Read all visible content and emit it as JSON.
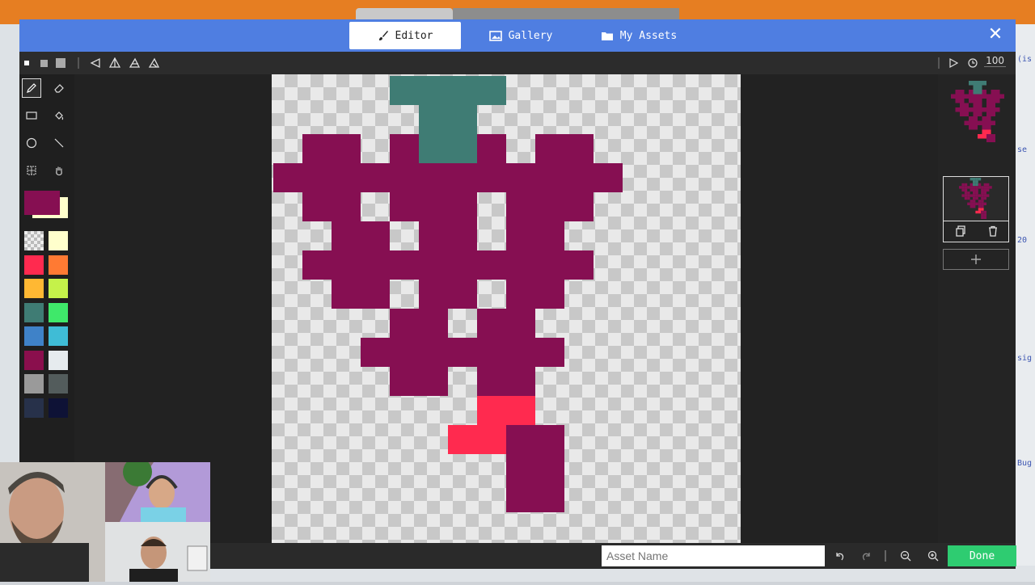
{
  "tabs": [
    {
      "label": "Editor",
      "icon": "brush-icon"
    },
    {
      "label": "Gallery",
      "icon": "image-icon"
    },
    {
      "label": "My Assets",
      "icon": "folder-icon"
    }
  ],
  "toolbar": {
    "timer": "100"
  },
  "asset_name": {
    "placeholder": "Asset Name",
    "value": ""
  },
  "done_label": "Done",
  "palette": [
    "#ffffcc",
    "#ff2a4f",
    "#ff7a33",
    "#ffb833",
    "#c5f24a",
    "#3f7c74",
    "#3fe86a",
    "#3f82c8",
    "#3fbcd6",
    "#8a0f4d",
    "#e6ebee",
    "#9a9a9a",
    "#535c5c",
    "#27314a",
    "#0e1236"
  ],
  "colors": {
    "primary": "#860f52",
    "secondary": "#ffffcc",
    "stem": "#3f7c74",
    "accent": "#ff2a4f",
    "header": "#4f7ee1",
    "done": "#2ecc71"
  },
  "pixels": [
    "....0000....",
    ".....00.....",
    ".11.1001.11.",
    "111111111111",
    ".11.111.111.",
    "..11.11.11..",
    ".1111111111.",
    "..11.11.11..",
    "....11.11...",
    "...1111111..",
    "....11.11...",
    ".......22...",
    "......2211..",
    "........11..",
    "........11.."
  ],
  "side_text": [
    "(is",
    "se",
    "20",
    "sig",
    "Bug"
  ]
}
